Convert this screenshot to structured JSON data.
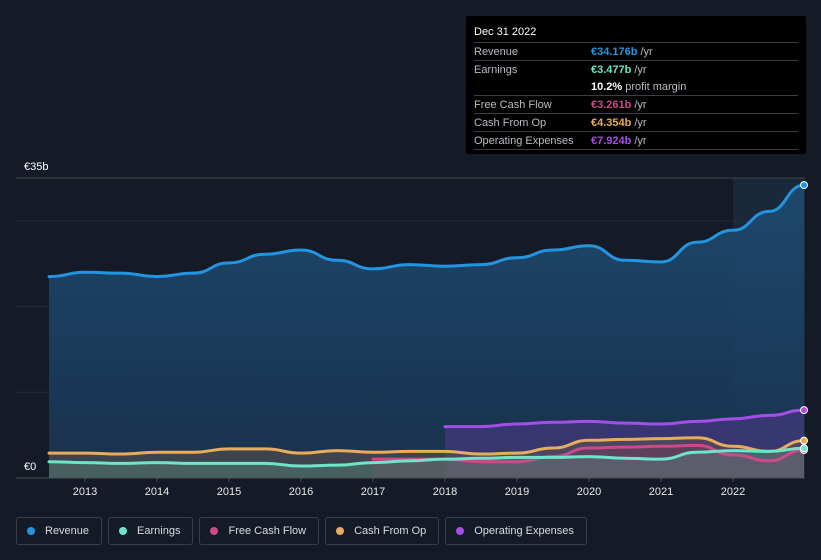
{
  "tooltip": {
    "date": "Dec 31 2022",
    "rows": [
      {
        "label": "Revenue",
        "value": "€34.176b",
        "unit": "/yr",
        "color": "#2394df"
      },
      {
        "label": "Earnings",
        "value": "€3.477b",
        "unit": "/yr",
        "color": "#6ce5c8"
      },
      {
        "label": "",
        "value": "10.2%",
        "unit": "profit margin",
        "color": "#ffffff"
      },
      {
        "label": "Free Cash Flow",
        "value": "€3.261b",
        "unit": "/yr",
        "color": "#cc4a8b"
      },
      {
        "label": "Cash From Op",
        "value": "€4.354b",
        "unit": "/yr",
        "color": "#e8ac5c"
      },
      {
        "label": "Operating Expenses",
        "value": "€7.924b",
        "unit": "/yr",
        "color": "#a44ee8"
      }
    ]
  },
  "legend": [
    {
      "label": "Revenue",
      "color": "#2394df"
    },
    {
      "label": "Earnings",
      "color": "#6ce5c8"
    },
    {
      "label": "Free Cash Flow",
      "color": "#cc4a8b"
    },
    {
      "label": "Cash From Op",
      "color": "#e8ac5c"
    },
    {
      "label": "Operating Expenses",
      "color": "#a44ee8"
    }
  ],
  "chart_data": {
    "type": "area",
    "title": "",
    "xlabel": "",
    "ylabel": "",
    "y_unit": "EUR billions",
    "ylim": [
      0,
      35
    ],
    "xlim": [
      2012.5,
      2023.0
    ],
    "y_tick_labels": [
      {
        "value": 35,
        "label": "€35b"
      },
      {
        "value": 0,
        "label": "€0"
      }
    ],
    "gridlines": [
      0,
      10,
      20,
      30,
      35
    ],
    "x_tick_labels": [
      "2013",
      "2014",
      "2015",
      "2016",
      "2017",
      "2018",
      "2019",
      "2020",
      "2021",
      "2022"
    ],
    "x_ticks": [
      2013,
      2014,
      2015,
      2016,
      2017,
      2018,
      2019,
      2020,
      2021,
      2022
    ],
    "highlight_range": [
      2022.0,
      2023.0
    ],
    "legend_position": "bottom",
    "series": [
      {
        "name": "Revenue",
        "color": "#2394df",
        "x": [
          2012.5,
          2013.0,
          2013.5,
          2014.0,
          2014.5,
          2015.0,
          2015.5,
          2016.0,
          2016.5,
          2017.0,
          2017.5,
          2018.0,
          2018.5,
          2019.0,
          2019.5,
          2020.0,
          2020.5,
          2021.0,
          2021.5,
          2022.0,
          2022.5,
          2023.0
        ],
        "values": [
          23.5,
          24.0,
          23.9,
          23.5,
          23.9,
          25.1,
          26.1,
          26.6,
          25.4,
          24.4,
          24.9,
          24.7,
          24.9,
          25.7,
          26.6,
          27.1,
          25.4,
          25.2,
          27.5,
          28.9,
          31.1,
          34.176
        ]
      },
      {
        "name": "Operating Expenses",
        "color": "#a44ee8",
        "x": [
          2018.0,
          2018.5,
          2019.0,
          2019.5,
          2020.0,
          2020.5,
          2021.0,
          2021.5,
          2022.0,
          2022.5,
          2023.0
        ],
        "values": [
          6.0,
          6.0,
          6.3,
          6.5,
          6.6,
          6.4,
          6.3,
          6.6,
          6.9,
          7.3,
          7.924
        ]
      },
      {
        "name": "Cash From Op",
        "color": "#e8ac5c",
        "x": [
          2012.5,
          2013.0,
          2013.5,
          2014.0,
          2014.5,
          2015.0,
          2015.5,
          2016.0,
          2016.5,
          2017.0,
          2017.5,
          2018.0,
          2018.5,
          2019.0,
          2019.5,
          2020.0,
          2020.5,
          2021.0,
          2021.5,
          2022.0,
          2022.5,
          2023.0
        ],
        "values": [
          2.9,
          2.9,
          2.8,
          3.0,
          3.0,
          3.4,
          3.4,
          2.9,
          3.2,
          3.0,
          3.1,
          3.1,
          2.8,
          2.9,
          3.5,
          4.4,
          4.5,
          4.6,
          4.7,
          3.7,
          3.1,
          4.354
        ]
      },
      {
        "name": "Free Cash Flow",
        "color": "#cc4a8b",
        "x": [
          2017.0,
          2017.5,
          2018.0,
          2018.5,
          2019.0,
          2019.5,
          2020.0,
          2020.5,
          2021.0,
          2021.5,
          2022.0,
          2022.5,
          2023.0
        ],
        "values": [
          2.2,
          2.2,
          2.2,
          1.9,
          1.9,
          2.5,
          3.5,
          3.6,
          3.7,
          3.8,
          2.7,
          2.0,
          3.261
        ]
      },
      {
        "name": "Earnings",
        "color": "#6ce5c8",
        "x": [
          2012.5,
          2013.0,
          2013.5,
          2014.0,
          2014.5,
          2015.0,
          2015.5,
          2016.0,
          2016.5,
          2017.0,
          2017.5,
          2018.0,
          2018.5,
          2019.0,
          2019.5,
          2020.0,
          2020.5,
          2021.0,
          2021.5,
          2022.0,
          2022.5,
          2023.0
        ],
        "values": [
          1.9,
          1.8,
          1.7,
          1.8,
          1.7,
          1.7,
          1.7,
          1.4,
          1.5,
          1.8,
          2.0,
          2.2,
          2.3,
          2.4,
          2.4,
          2.5,
          2.3,
          2.2,
          3.0,
          3.2,
          3.1,
          3.477
        ]
      }
    ]
  }
}
